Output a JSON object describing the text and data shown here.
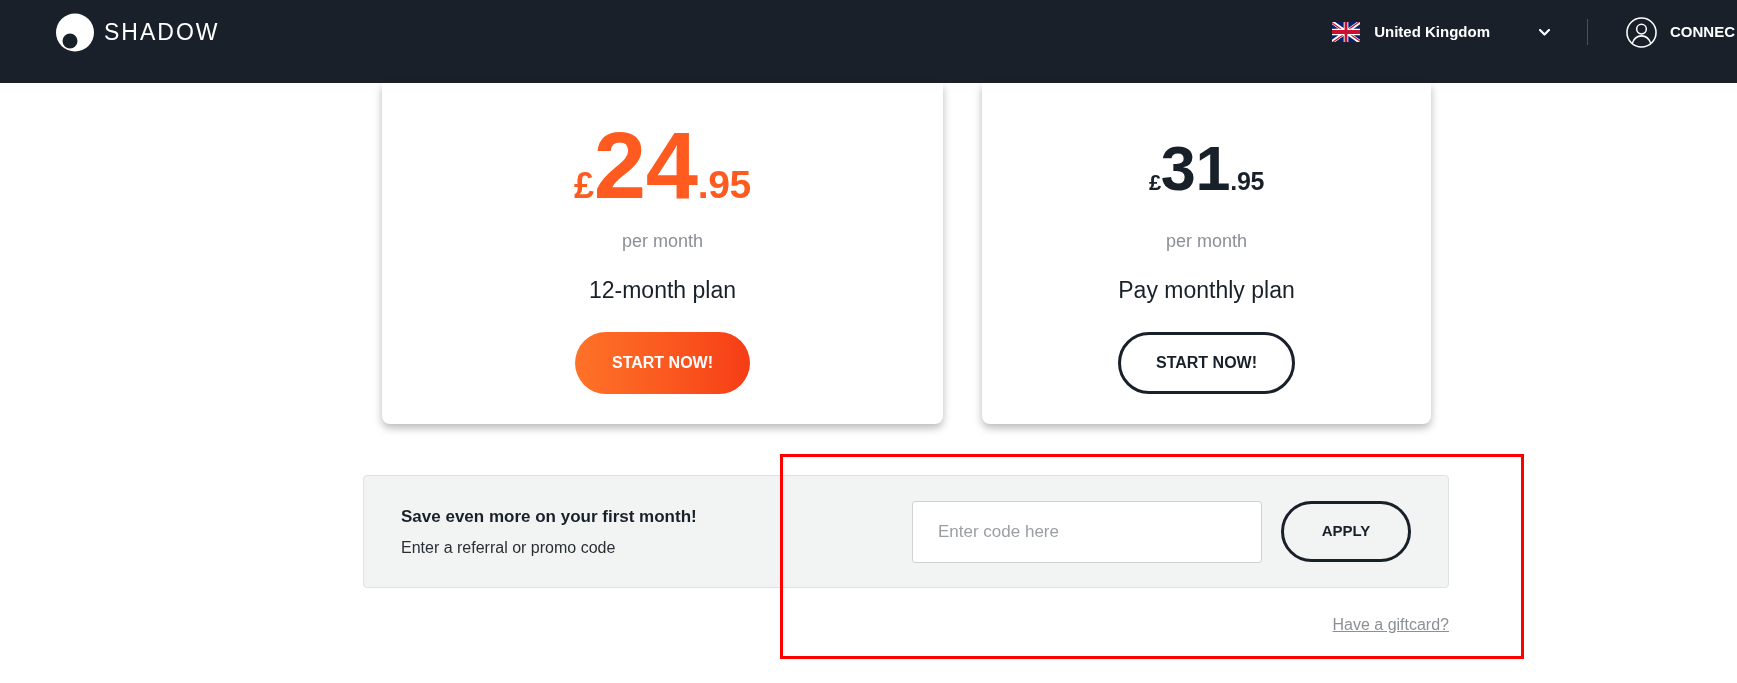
{
  "header": {
    "logo": {
      "text": "SHADOW"
    },
    "country_selector": {
      "label": "United Kingdom"
    },
    "account_button": {
      "label": "CONNEC"
    }
  },
  "plans": [
    {
      "highlighted": true,
      "currency": "£",
      "amount": "24",
      "cents": ".95",
      "period": "per month",
      "name": "12-month plan",
      "button": "START NOW!"
    },
    {
      "highlighted": false,
      "currency": "£",
      "amount": "31",
      "cents": ".95",
      "period": "per month",
      "name": "Pay monthly plan",
      "button": "START NOW!"
    }
  ],
  "promo": {
    "title": "Save even more on your first month!",
    "subtitle": "Enter a referral or promo code",
    "input": {
      "placeholder": "Enter code here"
    },
    "button": "APPLY"
  },
  "giftcard_link": "Have a giftcard?"
}
